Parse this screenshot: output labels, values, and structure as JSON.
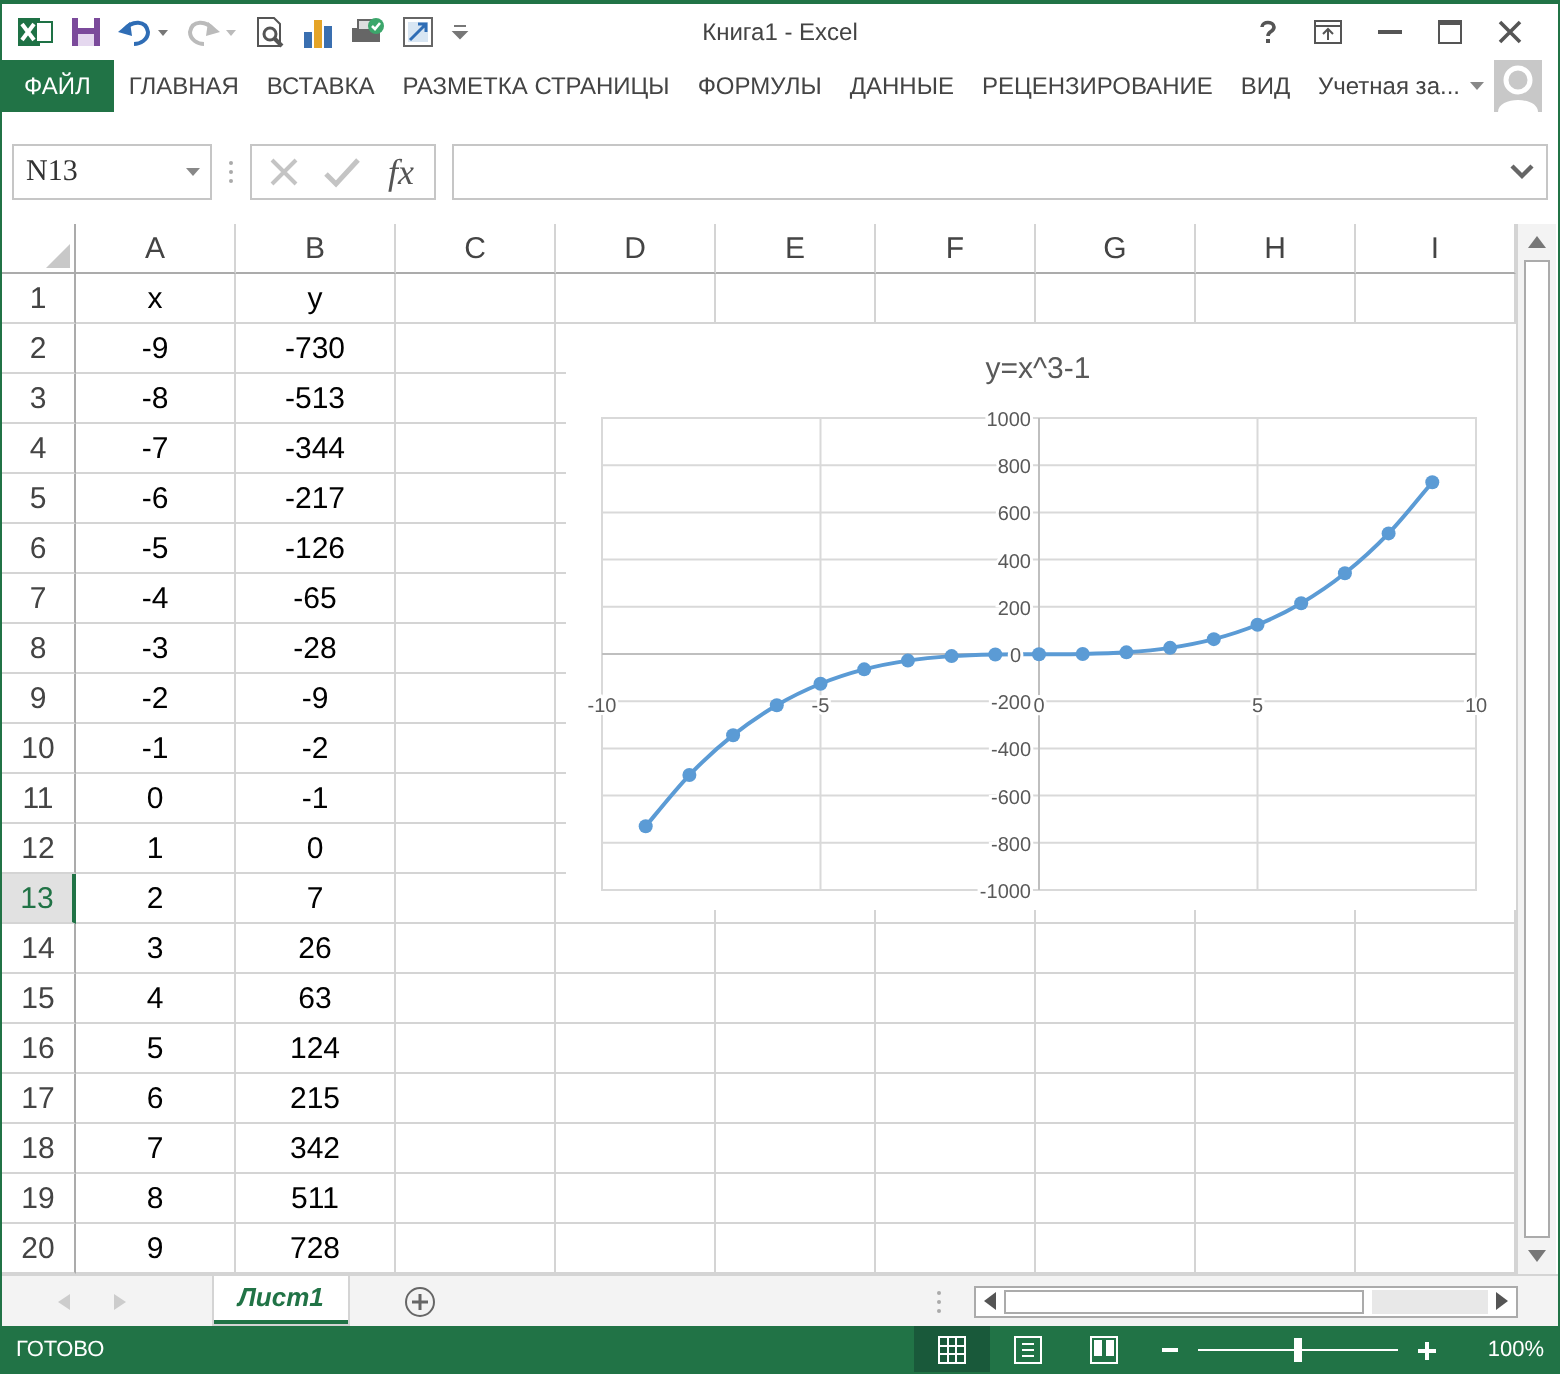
{
  "window": {
    "title": "Книга1 - Excel",
    "account": "Учетная за..."
  },
  "ribbon_tabs": [
    {
      "label": "ФАЙЛ",
      "kind": "file",
      "selected": false
    },
    {
      "label": "ГЛАВНАЯ",
      "kind": "tab",
      "selected": false
    },
    {
      "label": "ВСТАВКА",
      "kind": "tab",
      "selected": false
    },
    {
      "label": "РАЗМЕТКА СТРАНИЦЫ",
      "kind": "tab",
      "selected": false
    },
    {
      "label": "ФОРМУЛЫ",
      "kind": "tab",
      "selected": false
    },
    {
      "label": "ДАННЫЕ",
      "kind": "tab",
      "selected": false
    },
    {
      "label": "РЕЦЕНЗИРОВАНИЕ",
      "kind": "tab",
      "selected": false
    },
    {
      "label": "ВИД",
      "kind": "tab",
      "selected": false
    }
  ],
  "formula_bar": {
    "name_box": "N13",
    "function_button": "fx"
  },
  "columns": [
    {
      "label": "A"
    },
    {
      "label": "B"
    },
    {
      "label": "C"
    },
    {
      "label": "D"
    },
    {
      "label": "E"
    },
    {
      "label": "F"
    },
    {
      "label": "G"
    },
    {
      "label": "H"
    },
    {
      "label": "I"
    }
  ],
  "rows": [
    {
      "number": "1",
      "selected": false,
      "cells": [
        "x",
        "y"
      ]
    },
    {
      "number": "2",
      "selected": false,
      "cells": [
        "-9",
        "-730"
      ]
    },
    {
      "number": "3",
      "selected": false,
      "cells": [
        "-8",
        "-513"
      ]
    },
    {
      "number": "4",
      "selected": false,
      "cells": [
        "-7",
        "-344"
      ]
    },
    {
      "number": "5",
      "selected": false,
      "cells": [
        "-6",
        "-217"
      ]
    },
    {
      "number": "6",
      "selected": false,
      "cells": [
        "-5",
        "-126"
      ]
    },
    {
      "number": "7",
      "selected": false,
      "cells": [
        "-4",
        "-65"
      ]
    },
    {
      "number": "8",
      "selected": false,
      "cells": [
        "-3",
        "-28"
      ]
    },
    {
      "number": "9",
      "selected": false,
      "cells": [
        "-2",
        "-9"
      ]
    },
    {
      "number": "10",
      "selected": false,
      "cells": [
        "-1",
        "-2"
      ]
    },
    {
      "number": "11",
      "selected": false,
      "cells": [
        "0",
        "-1"
      ]
    },
    {
      "number": "12",
      "selected": false,
      "cells": [
        "1",
        "0"
      ]
    },
    {
      "number": "13",
      "selected": true,
      "cells": [
        "2",
        "7"
      ]
    },
    {
      "number": "14",
      "selected": false,
      "cells": [
        "3",
        "26"
      ]
    },
    {
      "number": "15",
      "selected": false,
      "cells": [
        "4",
        "63"
      ]
    },
    {
      "number": "16",
      "selected": false,
      "cells": [
        "5",
        "124"
      ]
    },
    {
      "number": "17",
      "selected": false,
      "cells": [
        "6",
        "215"
      ]
    },
    {
      "number": "18",
      "selected": false,
      "cells": [
        "7",
        "342"
      ]
    },
    {
      "number": "19",
      "selected": false,
      "cells": [
        "8",
        "511"
      ]
    },
    {
      "number": "20",
      "selected": false,
      "cells": [
        "9",
        "728"
      ]
    }
  ],
  "chart": {
    "chart_data": {
      "type": "line",
      "title": "y=x^3-1",
      "grid": true,
      "x": [
        -9,
        -8,
        -7,
        -6,
        -5,
        -4,
        -3,
        -2,
        -1,
        0,
        1,
        2,
        3,
        4,
        5,
        6,
        7,
        8,
        9
      ],
      "series": [
        {
          "color": "#5b9bd5",
          "marker": true,
          "values": [
            -730,
            -513,
            -344,
            -217,
            -126,
            -65,
            -28,
            -9,
            -2,
            -1,
            0,
            7,
            26,
            63,
            124,
            215,
            342,
            511,
            728
          ]
        }
      ],
      "xlim": [
        -10,
        10
      ],
      "ylim": [
        -1000,
        1000
      ],
      "xticks": [
        -10,
        -5,
        0,
        5,
        10
      ],
      "yticks": [
        -1000,
        -800,
        -600,
        -400,
        -200,
        0,
        200,
        400,
        600,
        800,
        1000
      ]
    }
  },
  "sheet_tabs": [
    {
      "label": "Лист1",
      "selected": true
    }
  ],
  "status_bar": {
    "status": "ГОТОВО",
    "views": [
      {
        "kind": "normal",
        "selected": true
      },
      {
        "kind": "layout",
        "selected": false
      },
      {
        "kind": "pagebreak",
        "selected": false
      }
    ],
    "zoom": {
      "level": 0.5,
      "reading": "100%"
    }
  }
}
